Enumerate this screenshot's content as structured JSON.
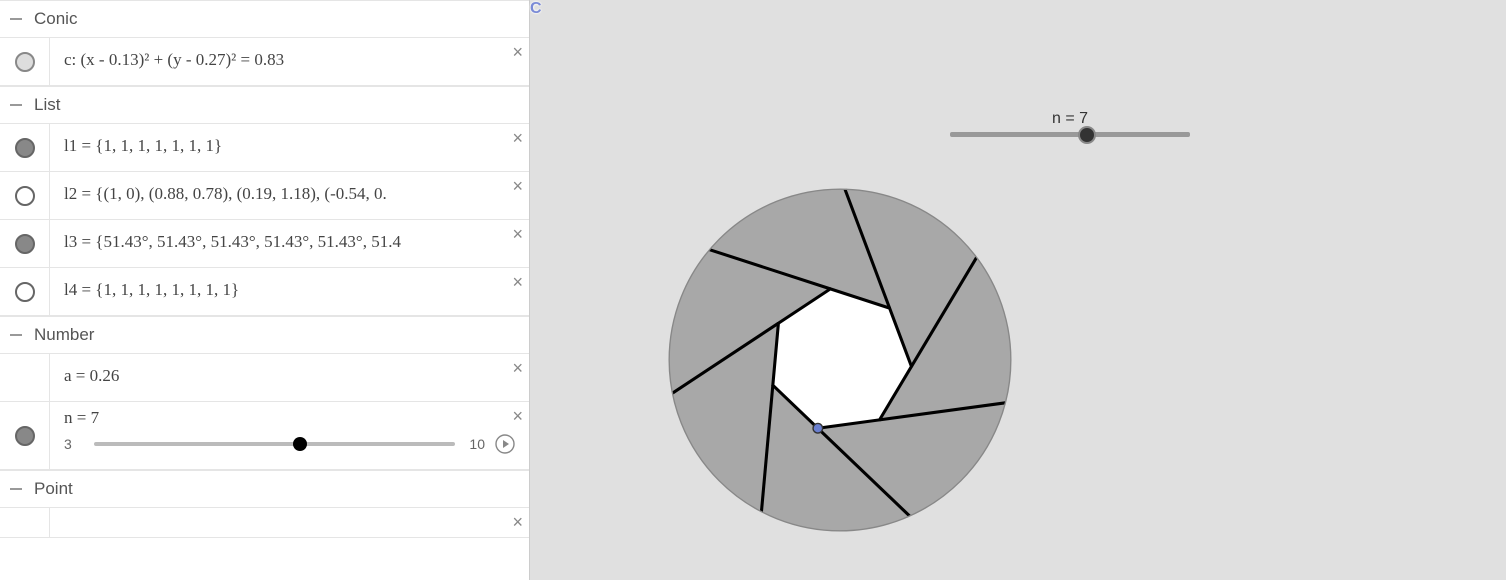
{
  "sections": {
    "conic": {
      "title": "Conic",
      "rows": [
        {
          "vis": "light",
          "expr": "c: (x - 0.13)² + (y - 0.27)² = 0.83"
        }
      ]
    },
    "list": {
      "title": "List",
      "rows": [
        {
          "vis": "filled",
          "expr": "l1 = {1, 1, 1, 1, 1, 1, 1}"
        },
        {
          "vis": "empty",
          "expr": "l2 = {(1, 0), (0.88, 0.78), (0.19, 1.18), (-0.54, 0."
        },
        {
          "vis": "filled",
          "expr": "l3 = {51.43°, 51.43°, 51.43°, 51.43°, 51.43°, 51.4"
        },
        {
          "vis": "empty",
          "expr": "l4 = {1, 1, 1, 1, 1, 1, 1, 1}"
        }
      ]
    },
    "number": {
      "title": "Number",
      "rows": [
        {
          "vis": "none",
          "expr": "a = 0.26"
        }
      ],
      "slider": {
        "vis": "filled",
        "label": "n = 7",
        "min": "3",
        "max": "10",
        "value": 7,
        "range": [
          3,
          10
        ]
      }
    },
    "point": {
      "title": "Point"
    }
  },
  "canvas_slider": {
    "label": "n = 7",
    "value": 7,
    "range": [
      3,
      10
    ]
  },
  "canvas_point": {
    "label": "C"
  },
  "chart_data": {
    "type": "diagram",
    "n": 7,
    "circle": {
      "cx": 0.13,
      "cy": 0.27,
      "r_sq": 0.83
    },
    "lists": {
      "l1": [
        1,
        1,
        1,
        1,
        1,
        1,
        1
      ],
      "l3_deg": [
        51.43,
        51.43,
        51.43,
        51.43,
        51.43,
        51.43,
        51.43
      ],
      "l4": [
        1,
        1,
        1,
        1,
        1,
        1,
        1,
        1
      ]
    },
    "a": 0.26
  }
}
